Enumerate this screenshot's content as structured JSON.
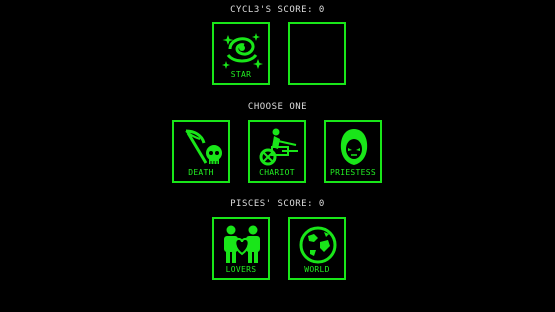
{
  "opponent": {
    "score_text": "CYCL3'S SCORE: 0"
  },
  "opponent_cards": [
    {
      "label": "STAR",
      "icon": "star-swirl-icon"
    },
    {
      "label": "",
      "icon": ""
    }
  ],
  "prompt": "CHOOSE ONE",
  "choices": [
    {
      "label": "DEATH",
      "icon": "scythe-skull-icon"
    },
    {
      "label": "CHARIOT",
      "icon": "chariot-rider-icon"
    },
    {
      "label": "PRIESTESS",
      "icon": "hooded-figure-icon"
    }
  ],
  "player": {
    "score_text": "PISCES' SCORE: 0"
  },
  "player_cards": [
    {
      "label": "LOVERS",
      "icon": "lovers-heart-icon"
    },
    {
      "label": "WORLD",
      "icon": "globe-world-icon"
    }
  ],
  "colors": {
    "accent": "#19e619",
    "background": "#000000",
    "text": "#dcdcdc"
  }
}
